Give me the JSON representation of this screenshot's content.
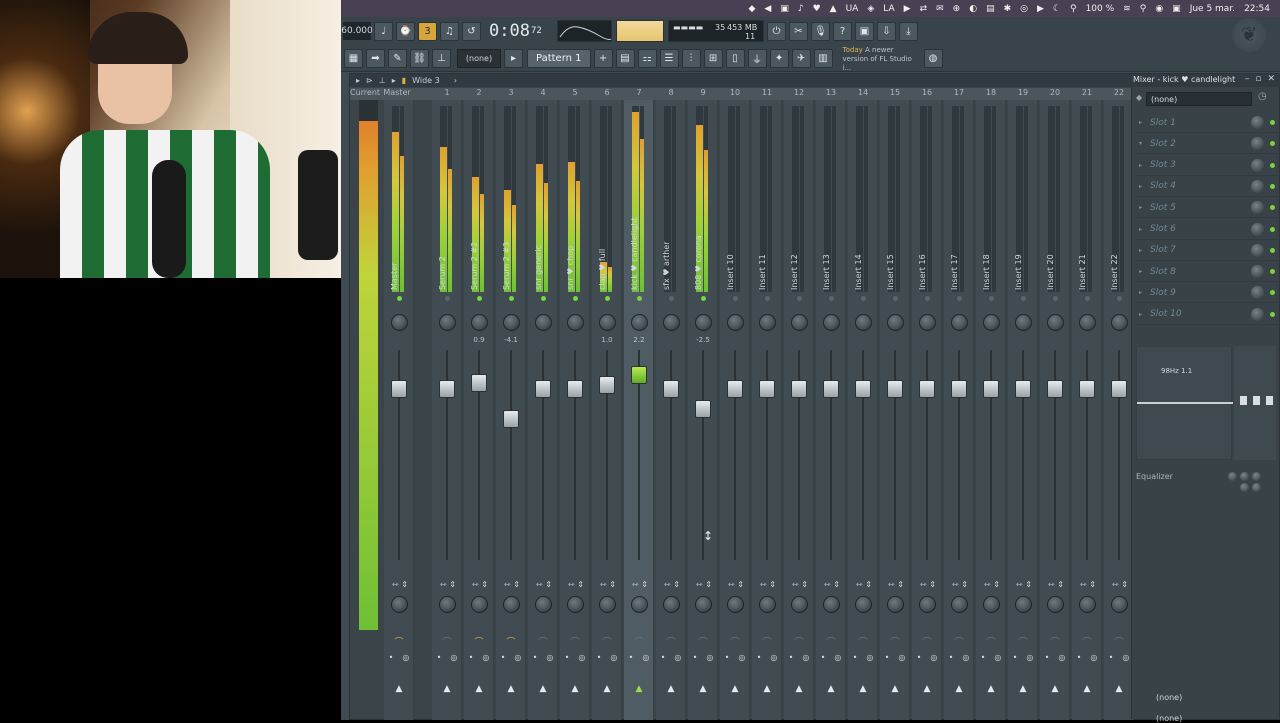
{
  "menubar": {
    "items": [
      "◆",
      "◀",
      "▣",
      "♪",
      "♥",
      "▲",
      "UA",
      "◈",
      "LA",
      "▶",
      "⇄",
      "✉",
      "⊕",
      "◐",
      "▤",
      "✱",
      "◎",
      "▶",
      "☾",
      "⚲",
      "100 %",
      "≋",
      "⚲",
      "◉",
      "▣"
    ],
    "date": "Jue 5 mar.",
    "clock": "22:54"
  },
  "toolbar": {
    "tempo": "60.000",
    "time_main": "0:08",
    "time_sub": "72",
    "mem_top": "35",
    "mem_mb": "453 MB",
    "mem_bottom": "11",
    "pattern_label": "Pattern 1",
    "none_label": "(none)",
    "hint_today": "Today",
    "hint_text": "A newer version of FL Studio i..."
  },
  "mixer": {
    "title": "Mixer - kick ♥ candlelight",
    "breadcrumb": "Wide 3",
    "current_label": "Current",
    "master_label": "Master",
    "preset": "(none)",
    "route_in": "(none)",
    "route_out": "(none)",
    "eq_label": "Equalizer",
    "eq_readout": "98Hz 1.1",
    "slots": [
      "Slot 1",
      "Slot 2",
      "Slot 3",
      "Slot 4",
      "Slot 5",
      "Slot 6",
      "Slot 7",
      "Slot 8",
      "Slot 9",
      "Slot 10"
    ],
    "channels": [
      {
        "num": "",
        "name": "Master",
        "meter": 0.86,
        "fader": 0.0,
        "led": true,
        "kval": "",
        "stereo": true,
        "sel": false
      },
      {
        "num": "1",
        "name": "Serum 2",
        "meter": 0.78,
        "fader": 0.0,
        "led": false,
        "kval": "",
        "stereo": false,
        "sel": false
      },
      {
        "num": "2",
        "name": "Serum 2 #2",
        "meter": 0.62,
        "fader": 0.03,
        "led": true,
        "kval": "0.9",
        "stereo": true,
        "sel": false
      },
      {
        "num": "3",
        "name": "Serum 2 #3",
        "meter": 0.55,
        "fader": -0.15,
        "led": true,
        "kval": "-4.1",
        "stereo": true,
        "sel": false
      },
      {
        "num": "4",
        "name": "snr generic",
        "meter": 0.69,
        "fader": 0.0,
        "led": true,
        "kval": "",
        "stereo": false,
        "sel": false
      },
      {
        "num": "5",
        "name": "snr ♥ chop",
        "meter": 0.7,
        "fader": 0.0,
        "led": true,
        "kval": "",
        "stereo": false,
        "sel": false
      },
      {
        "num": "6",
        "name": "clap ♥ full",
        "meter": 0.16,
        "fader": 0.02,
        "led": true,
        "kval": "1.0",
        "stereo": false,
        "sel": false
      },
      {
        "num": "7",
        "name": "kick ♥ candlelight",
        "meter": 0.97,
        "fader": 0.07,
        "led": true,
        "kval": "2.2",
        "stereo": false,
        "sel": true
      },
      {
        "num": "8",
        "name": "sfx ♥ arther",
        "meter": 0.0,
        "fader": 0.0,
        "led": false,
        "kval": "",
        "stereo": false,
        "sel": false
      },
      {
        "num": "9",
        "name": "808 ♥ corona",
        "meter": 0.9,
        "fader": -0.1,
        "led": true,
        "kval": "-2.5",
        "stereo": false,
        "sel": false
      },
      {
        "num": "10",
        "name": "Insert 10",
        "meter": 0,
        "fader": 0,
        "led": false,
        "kval": "",
        "stereo": false,
        "sel": false
      },
      {
        "num": "11",
        "name": "Insert 11",
        "meter": 0,
        "fader": 0,
        "led": false,
        "kval": "",
        "stereo": false,
        "sel": false
      },
      {
        "num": "12",
        "name": "Insert 12",
        "meter": 0,
        "fader": 0,
        "led": false,
        "kval": "",
        "stereo": false,
        "sel": false
      },
      {
        "num": "13",
        "name": "Insert 13",
        "meter": 0,
        "fader": 0,
        "led": false,
        "kval": "",
        "stereo": false,
        "sel": false
      },
      {
        "num": "14",
        "name": "Insert 14",
        "meter": 0,
        "fader": 0,
        "led": false,
        "kval": "",
        "stereo": false,
        "sel": false
      },
      {
        "num": "15",
        "name": "Insert 15",
        "meter": 0,
        "fader": 0,
        "led": false,
        "kval": "",
        "stereo": false,
        "sel": false
      },
      {
        "num": "16",
        "name": "Insert 16",
        "meter": 0,
        "fader": 0,
        "led": false,
        "kval": "",
        "stereo": false,
        "sel": false
      },
      {
        "num": "17",
        "name": "Insert 17",
        "meter": 0,
        "fader": 0,
        "led": false,
        "kval": "",
        "stereo": false,
        "sel": false
      },
      {
        "num": "18",
        "name": "Insert 18",
        "meter": 0,
        "fader": 0,
        "led": false,
        "kval": "",
        "stereo": false,
        "sel": false
      },
      {
        "num": "19",
        "name": "Insert 19",
        "meter": 0,
        "fader": 0,
        "led": false,
        "kval": "",
        "stereo": false,
        "sel": false
      },
      {
        "num": "20",
        "name": "Insert 20",
        "meter": 0,
        "fader": 0,
        "led": false,
        "kval": "",
        "stereo": false,
        "sel": false
      },
      {
        "num": "21",
        "name": "Insert 21",
        "meter": 0,
        "fader": 0,
        "led": false,
        "kval": "",
        "stereo": false,
        "sel": false
      },
      {
        "num": "22",
        "name": "Insert 22",
        "meter": 0,
        "fader": 0,
        "led": false,
        "kval": "",
        "stereo": false,
        "sel": false
      }
    ]
  },
  "colors": {
    "accent": "#d8a53a",
    "meter_green": "#7bd23b",
    "selected_route": "#9ae04a"
  }
}
